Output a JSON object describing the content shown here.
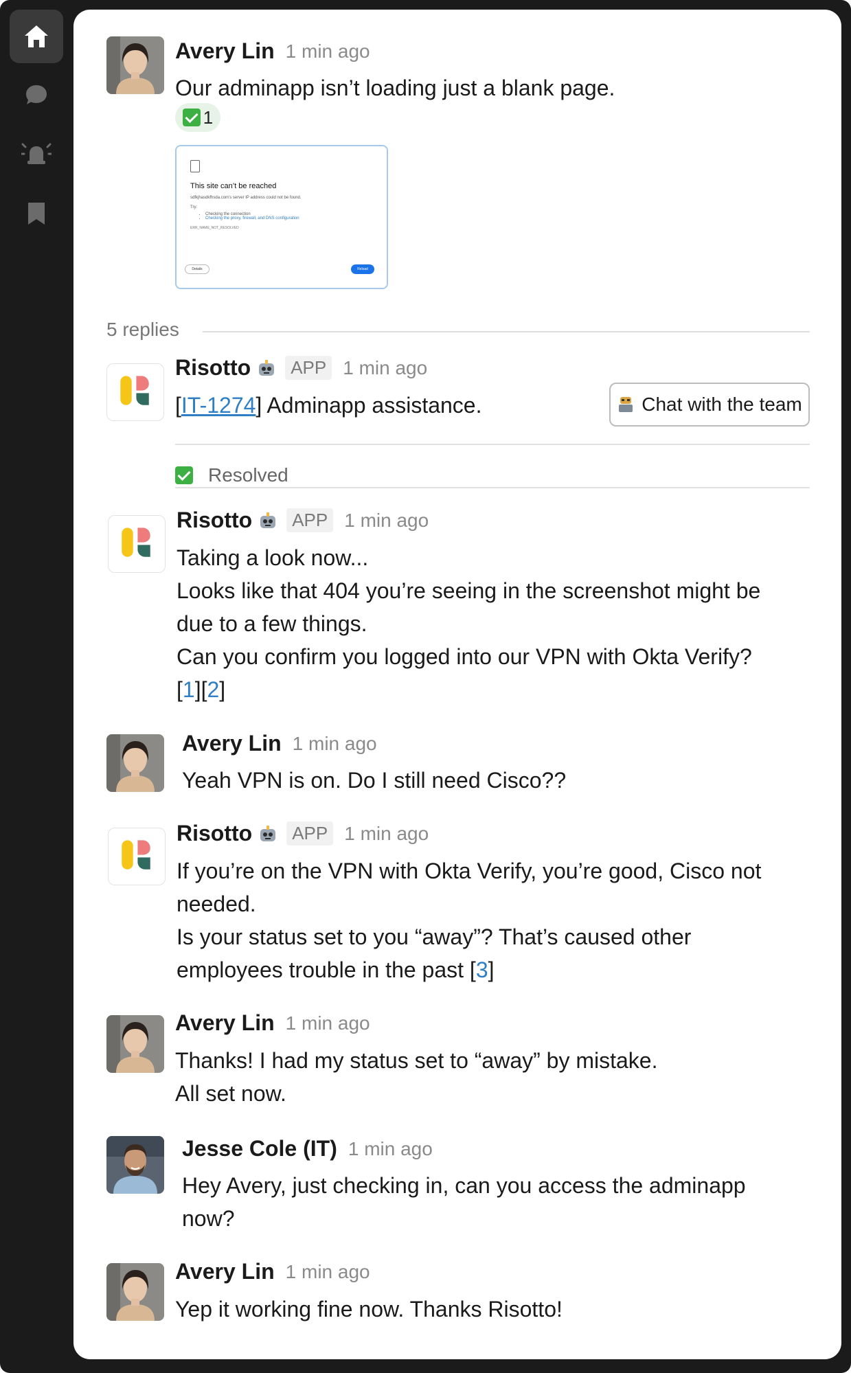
{
  "nav": {
    "items": [
      {
        "icon": "home-icon",
        "active": true
      },
      {
        "icon": "chat-bubble-icon",
        "active": false
      },
      {
        "icon": "alert-bell-icon",
        "active": false
      },
      {
        "icon": "bookmark-icon",
        "active": false
      }
    ]
  },
  "thread": {
    "root": {
      "author": "Avery Lin",
      "time": "1 min ago",
      "text": "Our adminapp isn’t loading just a blank page.",
      "reaction": {
        "emoji": "check-mark-icon",
        "count": "1"
      },
      "attachment": {
        "title": "This site can’t be reached",
        "subtitle": "sdfkjhasdkfhsda.com’s server IP address could not be found.",
        "try_label": "Try:",
        "tips": [
          "Checking the connection",
          "Checking the proxy, firewall, and DNS configuration"
        ],
        "error_code": "ERR_NAME_NOT_RESOLVED",
        "details_label": "Details",
        "reload_label": "Reload"
      }
    },
    "replies_label": "5 replies",
    "ticket": {
      "author": "Risotto",
      "badge": "APP",
      "time": "1 min ago",
      "open_bracket": "[",
      "ticket_id": "IT-1274",
      "close_text": "] Adminapp assistance.",
      "button_label": "Chat with the team",
      "status": "Resolved"
    },
    "messages": [
      {
        "author": "Risotto",
        "badge": "APP",
        "time": "1 min ago",
        "lines": [
          "Taking a look now...",
          "Looks like that 404 you’re seeing in the screenshot might be",
          "due to a few things.",
          "Can you confirm you logged into our VPN with Okta Verify?"
        ],
        "refs": [
          "1",
          "2"
        ]
      },
      {
        "author": "Avery Lin",
        "time": "1 min ago",
        "lines": [
          "Yeah VPN is on. Do I still need Cisco??"
        ]
      },
      {
        "author": "Risotto",
        "badge": "APP",
        "time": "1 min ago",
        "lines": [
          "If you’re on the VPN with Okta Verify, you’re good, Cisco not",
          "needed.",
          "Is your status set to you “away”? That’s caused other",
          "employees trouble in the past ["
        ],
        "refs": [
          "3"
        ]
      },
      {
        "author": "Avery Lin",
        "time": "1 min ago",
        "lines": [
          "Thanks! I had my status set to “away” by mistake.",
          "All set now."
        ]
      },
      {
        "author": "Jesse Cole (IT)",
        "time": "1 min ago",
        "lines": [
          "Hey Avery, just checking in, can you access the adminapp",
          "now?"
        ]
      },
      {
        "author": "Avery Lin",
        "time": "1 min ago",
        "lines": [
          "Yep it working fine now. Thanks Risotto!"
        ]
      }
    ]
  },
  "colors": {
    "accent_link": "#2f7fc6",
    "sidebar_bg": "#1b1b1b",
    "success_green": "#3cb043",
    "logo_yellow": "#f5c518",
    "logo_pink": "#ef7c7c",
    "logo_teal": "#2f6b5e"
  }
}
